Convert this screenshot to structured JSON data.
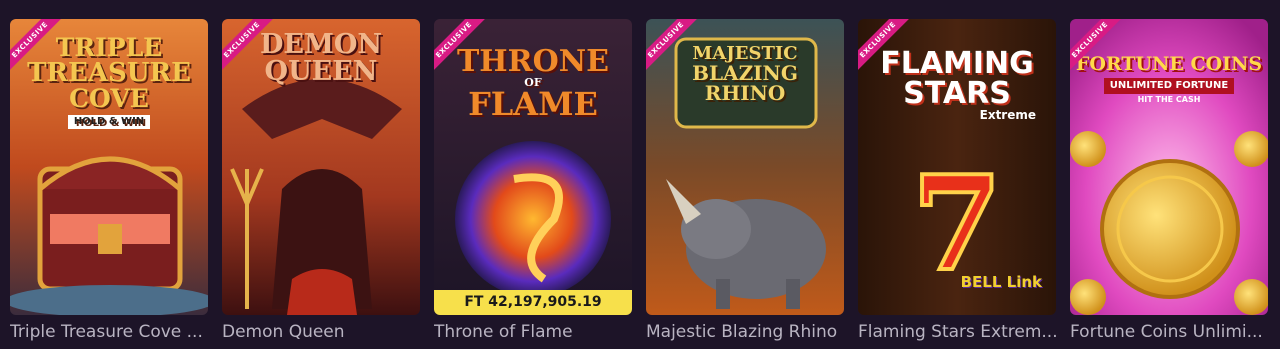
{
  "badge": "EXCLUSIVE",
  "games": [
    {
      "title": "Triple Treasure Cove ...",
      "logo_lines": [
        "TRIPLE",
        "TREASURE",
        "COVE"
      ],
      "logo_tag": "HOLD & WIN"
    },
    {
      "title": "Demon Queen",
      "logo_lines": [
        "DEMON",
        "QUEEN"
      ]
    },
    {
      "title": "Throne of Flame",
      "logo_lines": [
        "THRONE",
        "OF",
        "FLAME"
      ],
      "jackpot": "FT 42,197,905.19"
    },
    {
      "title": "Majestic Blazing Rhino",
      "logo_lines": [
        "MAJESTIC",
        "BLAZING",
        "RHINO"
      ]
    },
    {
      "title": "Flaming Stars Extrem...",
      "logo_lines": [
        "FLAMING",
        "STARS",
        "Extreme"
      ],
      "logo_tag": "BELL Link"
    },
    {
      "title": "Fortune Coins Unlimi...",
      "logo_lines": [
        "FORTUNE COINS",
        "UNLIMITED FORTUNE",
        "HIT THE CASH"
      ]
    }
  ],
  "colors": {
    "background": "#1d1428",
    "badge": "#d81b84",
    "jackpot_bg": "#f7e04b"
  }
}
